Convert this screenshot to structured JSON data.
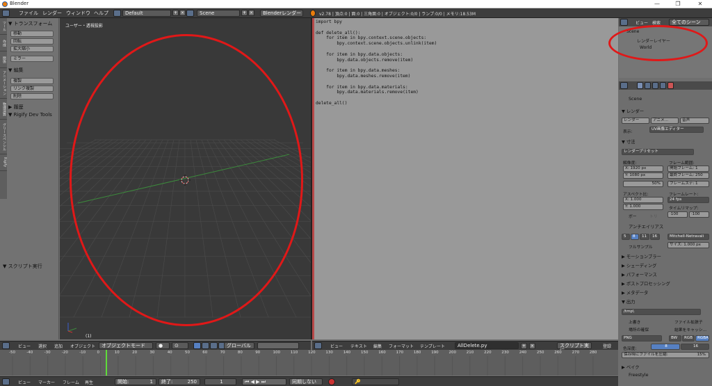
{
  "window": {
    "title": "Blender"
  },
  "topbar": {
    "menus": [
      "ファイル",
      "レンダー",
      "ウィンドウ",
      "ヘルプ"
    ],
    "layout": "Default",
    "scene": "Scene",
    "engine": "Blenderレンダー",
    "info": "v2.78 | 頂点:0 | 面:0 | 三角面:0 | オブジェクト:0/0 | ランプ:0/0 | メモリ:18.53M"
  },
  "left_toolbar": {
    "tabs": [
      "ツール",
      "作成",
      "関係",
      "アニメーション",
      "物理演算",
      "グリースペンシル",
      "Rigify"
    ],
    "transform_header": "▼ トランスフォーム",
    "transform_buttons": [
      "移動",
      "回転",
      "拡大縮小"
    ],
    "mirror": "ミラー",
    "edit_header": "▼ 編集",
    "edit_buttons": [
      "複製",
      "リンク複製",
      "削除"
    ],
    "history_header": "▶ 履歴",
    "rigify_header": "▼ Rigify Dev Tools",
    "script_header": "▼ スクリプト実行"
  },
  "viewport": {
    "label": "ユーザー・透視投影",
    "frame_label": "(1)"
  },
  "text_editor": {
    "code": "import bpy\n\ndef delete_all():\n    for item in bpy.context.scene.objects:\n        bpy.context.scene.objects.unlink(item)\n\n    for item in bpy.data.objects:\n        bpy.data.objects.remove(item)\n\n    for item in bpy.data.meshes:\n        bpy.data.meshes.remove(item)\n\n    for item in bpy.data.materials:\n        bpy.data.materials.remove(item)\n\ndelete_all()"
  },
  "outliner": {
    "header_view": "ビュー",
    "header_search": "検索",
    "header_scope": "全てのシーン",
    "rows": [
      "Scene",
      "レンダーレイヤー",
      "World"
    ]
  },
  "properties": {
    "scene_name": "Scene",
    "render_header": "▼ レンダー",
    "render_buttons": [
      "レンダー",
      "アニメ...",
      "音声"
    ],
    "display_label": "表示:",
    "display_value": "UV画像エディター",
    "dimensions_header": "▼ 寸法",
    "render_preset": "レンダープリセット",
    "resolution_label": "解像度:",
    "frame_range_label": "フレーム範囲:",
    "res_x": "X:     1920 px",
    "res_y": "Y:     1080 px",
    "res_pct": "50%",
    "frame_start": "開始フレーム: 1",
    "frame_end": "最終フレーム: 250",
    "frame_step": "フレームステ: 1",
    "aspect_label": "アスペクト比:",
    "framerate_label": "フレームレート:",
    "aspect_x": "X:     1.000",
    "aspect_y": "Y:     1.000",
    "fps": "24 fps",
    "time_remap_label": "タイムリマップ:",
    "remap_old": "·100",
    "remap_new": "·100",
    "border": "ボー",
    "crop": "トリ",
    "aa_header": "アンチエイリアス",
    "aa_samples": [
      "5",
      "8",
      "11",
      "16"
    ],
    "aa_filter": "Mitchell-Netravali",
    "full_sample": "フルサンプル",
    "aa_size": "サイズ: 1.000 px",
    "collapsed": [
      "▶ モーションブラー",
      "▶ シェーディング",
      "▶ パフォーマンス",
      "▶ ポストプロセッシング",
      "▶ メタデータ"
    ],
    "output_header": "▼ 出力",
    "output_path": "/tmp\\",
    "overwrite": "上書き",
    "file_ext": "ファイル拡張子",
    "placeholders": "場所の確保",
    "cache_result": "結果をキャッシ...",
    "format": "PNG",
    "color_modes": [
      "BW",
      "RGB",
      "RGBA"
    ],
    "color_depth_label": "色深度:",
    "color_depth_values": [
      "8",
      "16"
    ],
    "compression": "保存時にファイルを圧縮:",
    "compression_value": "15%",
    "bake": "▶ ベイク",
    "freestyle": "Freestyle"
  },
  "view3d_header": {
    "menus": [
      "ビュー",
      "選択",
      "追加",
      "オブジェクト"
    ],
    "mode": "オブジェクトモード",
    "orientation": "グローバル"
  },
  "text_header": {
    "menus": [
      "ビュー",
      "テキスト",
      "編集",
      "フォーマット",
      "テンプレート"
    ],
    "filename": "AllDelete.py",
    "run_script": "スクリプト実行",
    "register": "登録"
  },
  "timeline": {
    "ticks": [
      "-50",
      "-40",
      "-30",
      "-20",
      "-10",
      "0",
      "10",
      "20",
      "30",
      "40",
      "50",
      "60",
      "70",
      "80",
      "90",
      "100",
      "110",
      "120",
      "130",
      "140",
      "150",
      "160",
      "170",
      "180",
      "190",
      "200",
      "210",
      "220",
      "230",
      "240",
      "250",
      "260",
      "270",
      "280"
    ],
    "current_frame": 1
  },
  "footer": {
    "menus": [
      "ビュー",
      "マーカー",
      "フレーム",
      "再生"
    ],
    "start": "開始:",
    "start_val": "1",
    "end": "終了:",
    "end_val": "250",
    "current": "1",
    "sync": "同期しない"
  },
  "colors": {
    "annotation": "#e01818",
    "playhead": "#5fdc3a",
    "accent": "#5680c2"
  }
}
